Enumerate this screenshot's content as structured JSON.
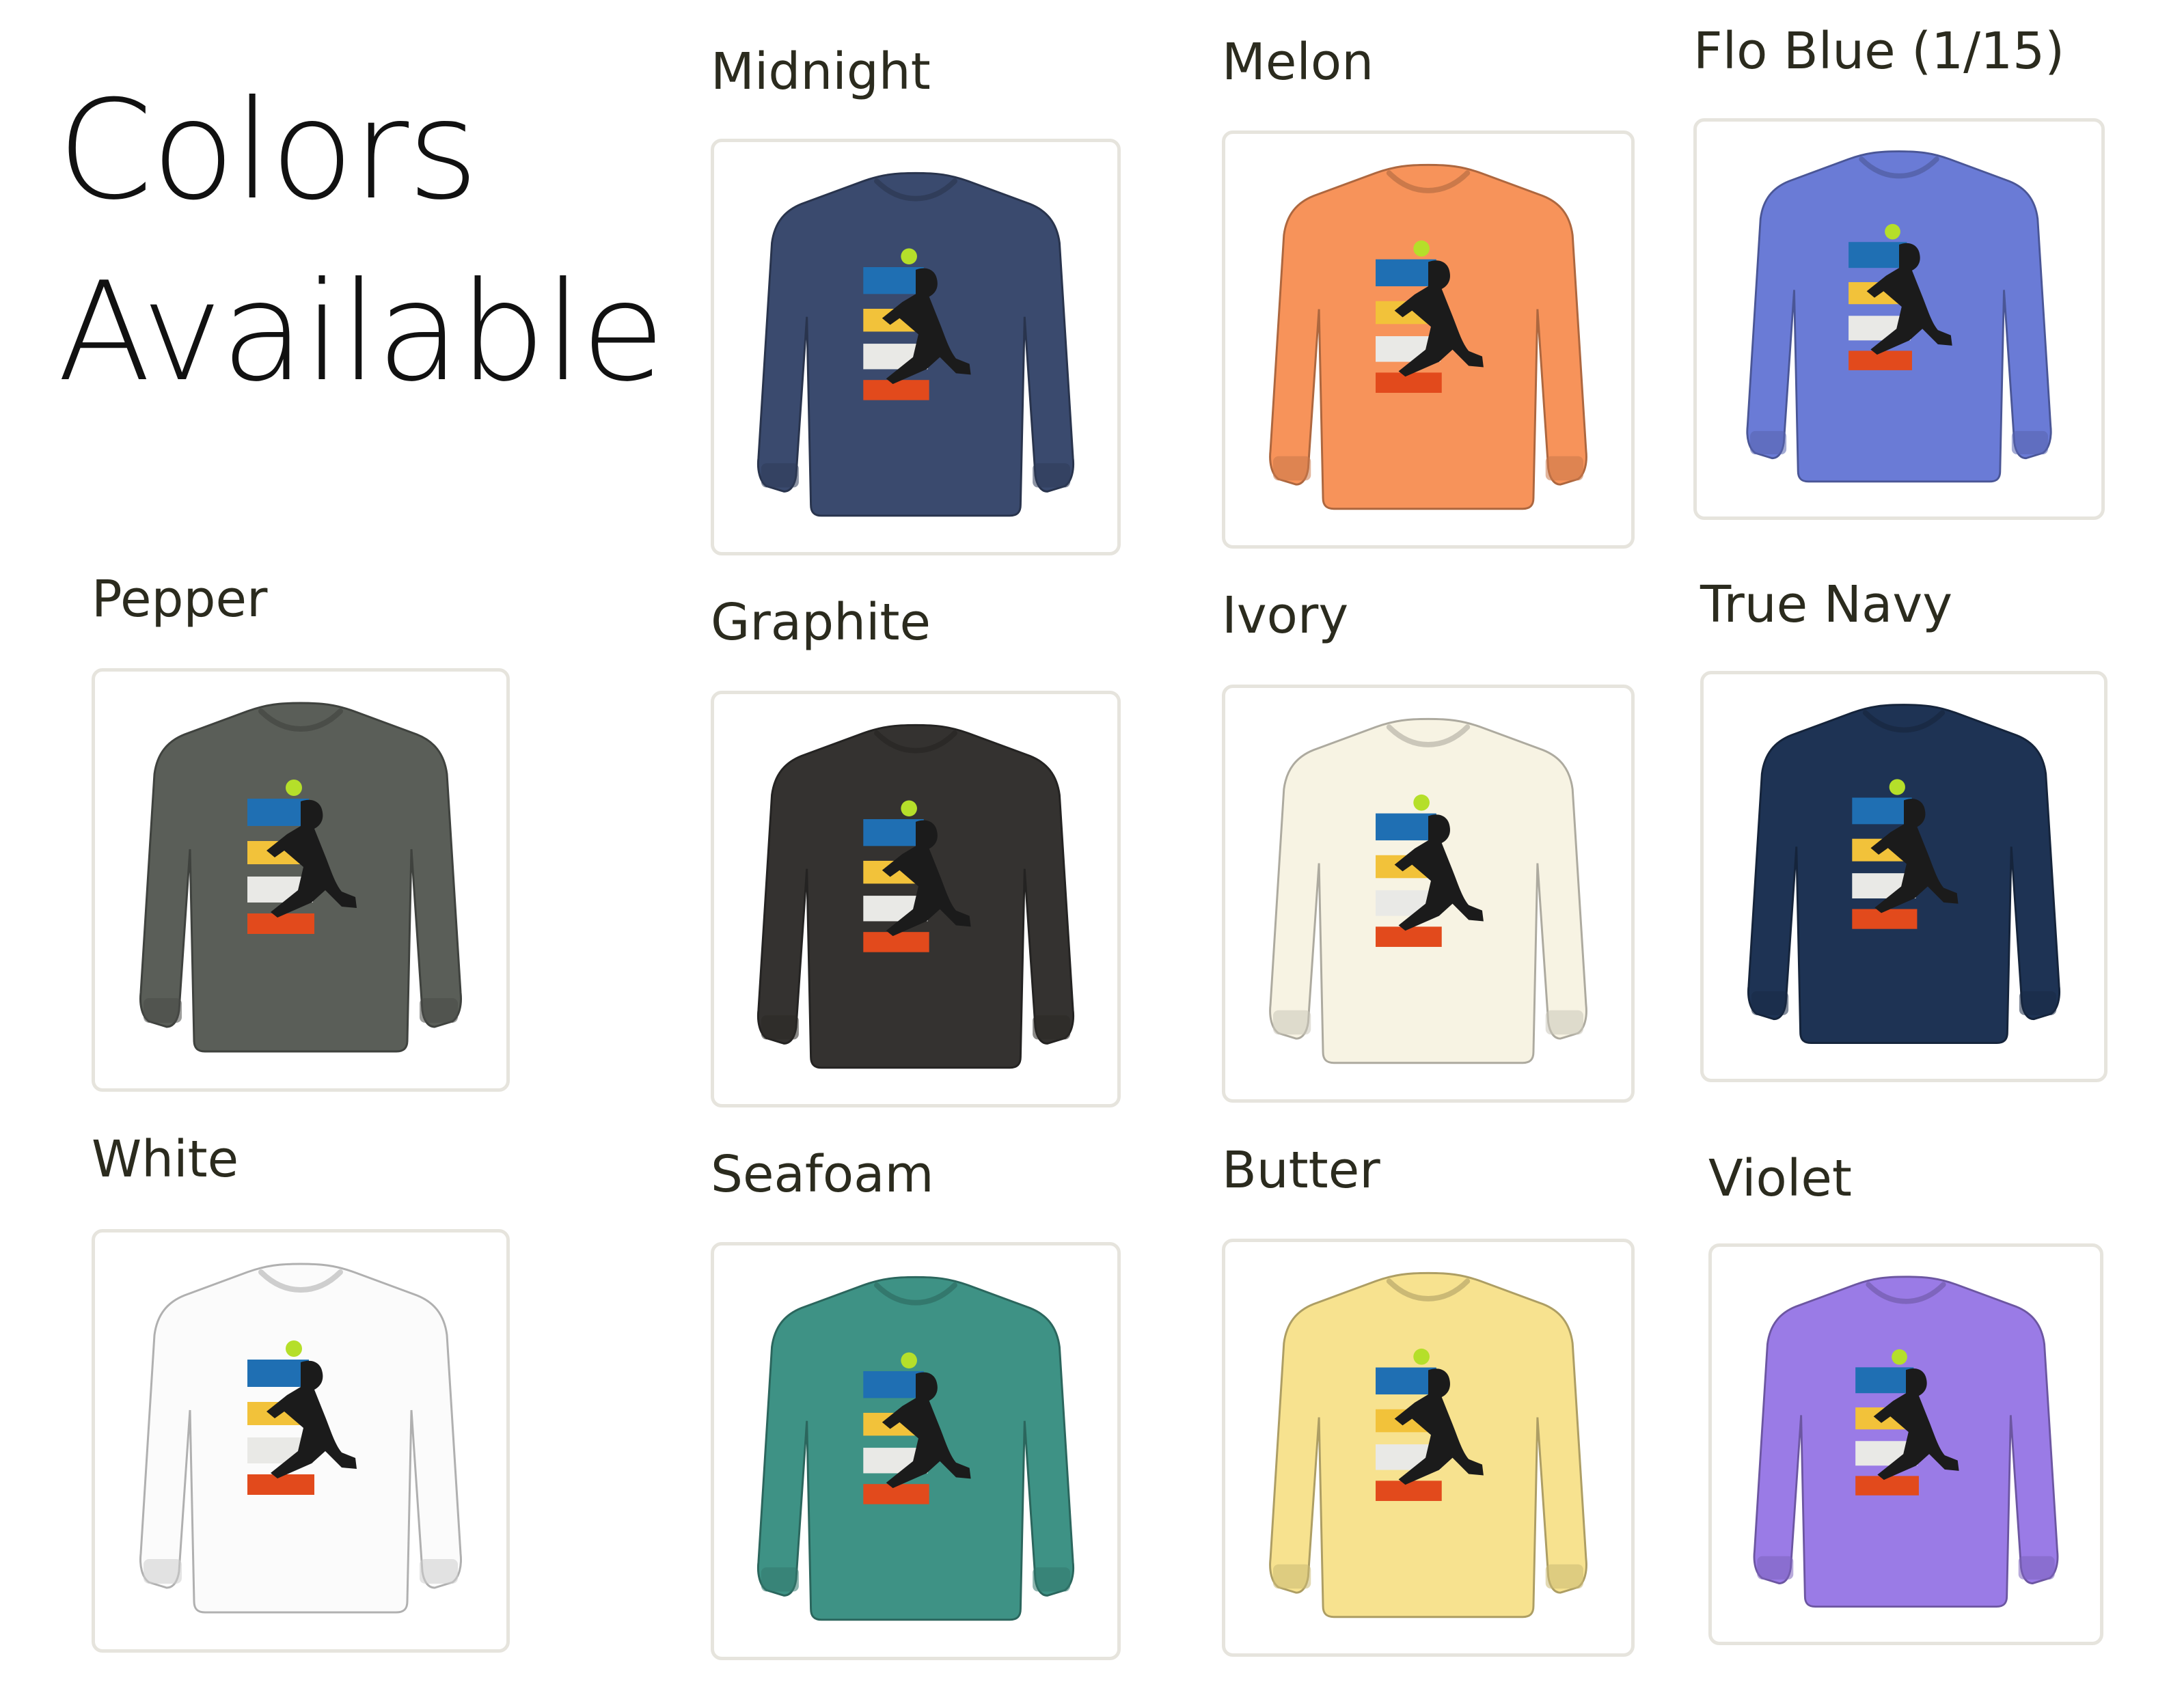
{
  "page": {
    "title_line1": "Colors",
    "title_line2": "Available"
  },
  "swatches": [
    {
      "name": "Midnight",
      "color": "#3a4a6e"
    },
    {
      "name": "Melon",
      "color": "#f7935a"
    },
    {
      "name": "Flo Blue  (1/15)",
      "color": "#6a7bd6"
    },
    {
      "name": "Pepper",
      "color": "#5a5e58"
    },
    {
      "name": "Graphite",
      "color": "#343230"
    },
    {
      "name": "Ivory",
      "color": "#f7f3e3"
    },
    {
      "name": "True Navy",
      "color": "#1e3354"
    },
    {
      "name": "White",
      "color": "#fbfbfb"
    },
    {
      "name": "Seafoam",
      "color": "#3e9285"
    },
    {
      "name": "Butter",
      "color": "#f7e28f"
    },
    {
      "name": "Violet",
      "color": "#9a7be6"
    }
  ]
}
